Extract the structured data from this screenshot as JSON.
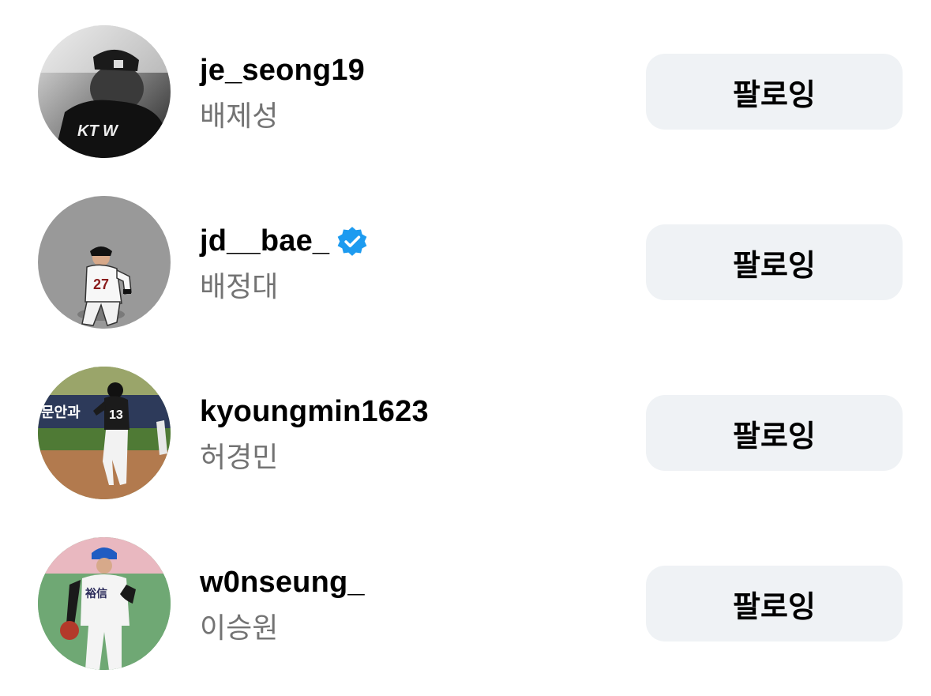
{
  "follow_list": [
    {
      "username": "je_seong19",
      "full_name": "배제성",
      "verified": false,
      "button_label": "팔로잉",
      "avatar_icon": "baseball-player-kt-wiz-bw-photo"
    },
    {
      "username": "jd__bae_",
      "full_name": "배정대",
      "verified": true,
      "button_label": "팔로잉",
      "avatar_icon": "baseball-player-27-illustration"
    },
    {
      "username": "kyoungmin1623",
      "full_name": "허경민",
      "verified": false,
      "button_label": "팔로잉",
      "avatar_icon": "baseball-player-13-running-photo"
    },
    {
      "username": "w0nseung_",
      "full_name": "이승원",
      "verified": false,
      "button_label": "팔로잉",
      "avatar_icon": "baseball-pitcher-blue-cap-photo"
    }
  ],
  "colors": {
    "button_bg": "#eff2f5",
    "secondary_text": "#737373",
    "verified_blue": "#1d9bf0"
  }
}
